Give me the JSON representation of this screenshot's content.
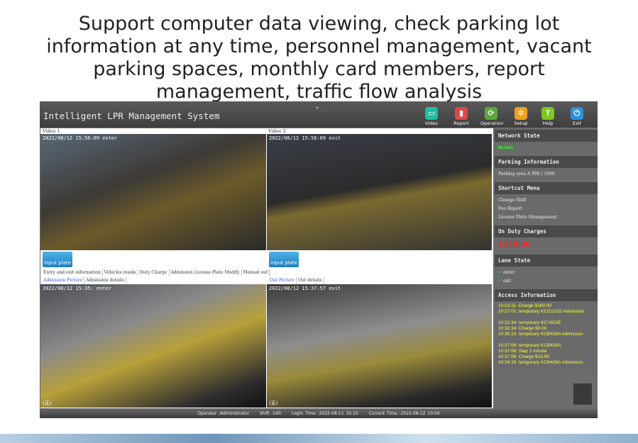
{
  "headline": [
    "Support computer data viewing, check parking lot",
    "information at any time, personnel management, vacant",
    "parking spaces, monthly card members, report",
    "management, traffic flow analysis"
  ],
  "app": {
    "title": "Intelligent LPR Management System",
    "toolbar": [
      {
        "label": "Video",
        "color": "#1cc0a0",
        "icon": "monitor-icon"
      },
      {
        "label": "Report",
        "color": "#e04848",
        "icon": "report-icon"
      },
      {
        "label": "Operation",
        "color": "#5aa83a",
        "icon": "operation-icon"
      },
      {
        "label": "Setup",
        "color": "#f0a020",
        "icon": "gear-icon"
      },
      {
        "label": "Help",
        "color": "#7cc820",
        "icon": "help-icon"
      },
      {
        "label": "Exit",
        "color": "#2a90e0",
        "icon": "power-icon"
      }
    ],
    "video1": {
      "label": "Video 1",
      "overlay": "2022/08/12  15:56:09  enter",
      "caption": ""
    },
    "video2": {
      "label": "Video 2",
      "overlay": "2022/08/12  15:56:09  exit"
    },
    "input_plate": "input plate",
    "tabs": [
      "Entry and exit information",
      "Vehicles inside",
      "Duty Charge",
      "Admission License Plate Modify",
      "Manual out"
    ],
    "admission_tabs": [
      "Admission Picture",
      "Admission details"
    ],
    "out_tabs": [
      "Out Picture",
      "Out details"
    ],
    "admission_overlay": "2022/08/12  15:35:  enter",
    "out_overlay": "2022/08/12  15:37:57  exit",
    "image_caption": "(无)",
    "sidebar": {
      "network_state": {
        "title": "Network State",
        "value": "Normal"
      },
      "parking_info": {
        "title": "Parking Information",
        "value": "Parking area A  996 / 1000"
      },
      "shortcut": {
        "title": "Shortcut Menu",
        "items": [
          "Change Shift",
          "Fee Report",
          "License Plate Management"
        ]
      },
      "charges": {
        "title": "On Duty Charges",
        "value": "$170.00"
      },
      "lane": {
        "title": "Lane State",
        "items": [
          "enter",
          "exit"
        ]
      },
      "access": {
        "title": "Access Information",
        "lines": [
          "10:23:11: Charge $160.00",
          "10:27:01: temporary KCG121G Admission",
          "",
          "10:32:34: temporary KCY823E",
          "10:32:34: Charge $0.00",
          "10:35:10: temporary KCB426A Admission",
          "",
          "10:37:56: temporary KCB426A",
          "10:37:56: Stay 2 minute",
          "10:37:56: Charge $10.00",
          "10:39:15: temporary KCB426A Admission"
        ]
      }
    },
    "status": {
      "operator": "Operator :Administrator",
      "shift": "Shift :140",
      "login": "Login Time :2022-08-12 10:10",
      "current": "Current Time :2022-08-12 10:56"
    }
  }
}
